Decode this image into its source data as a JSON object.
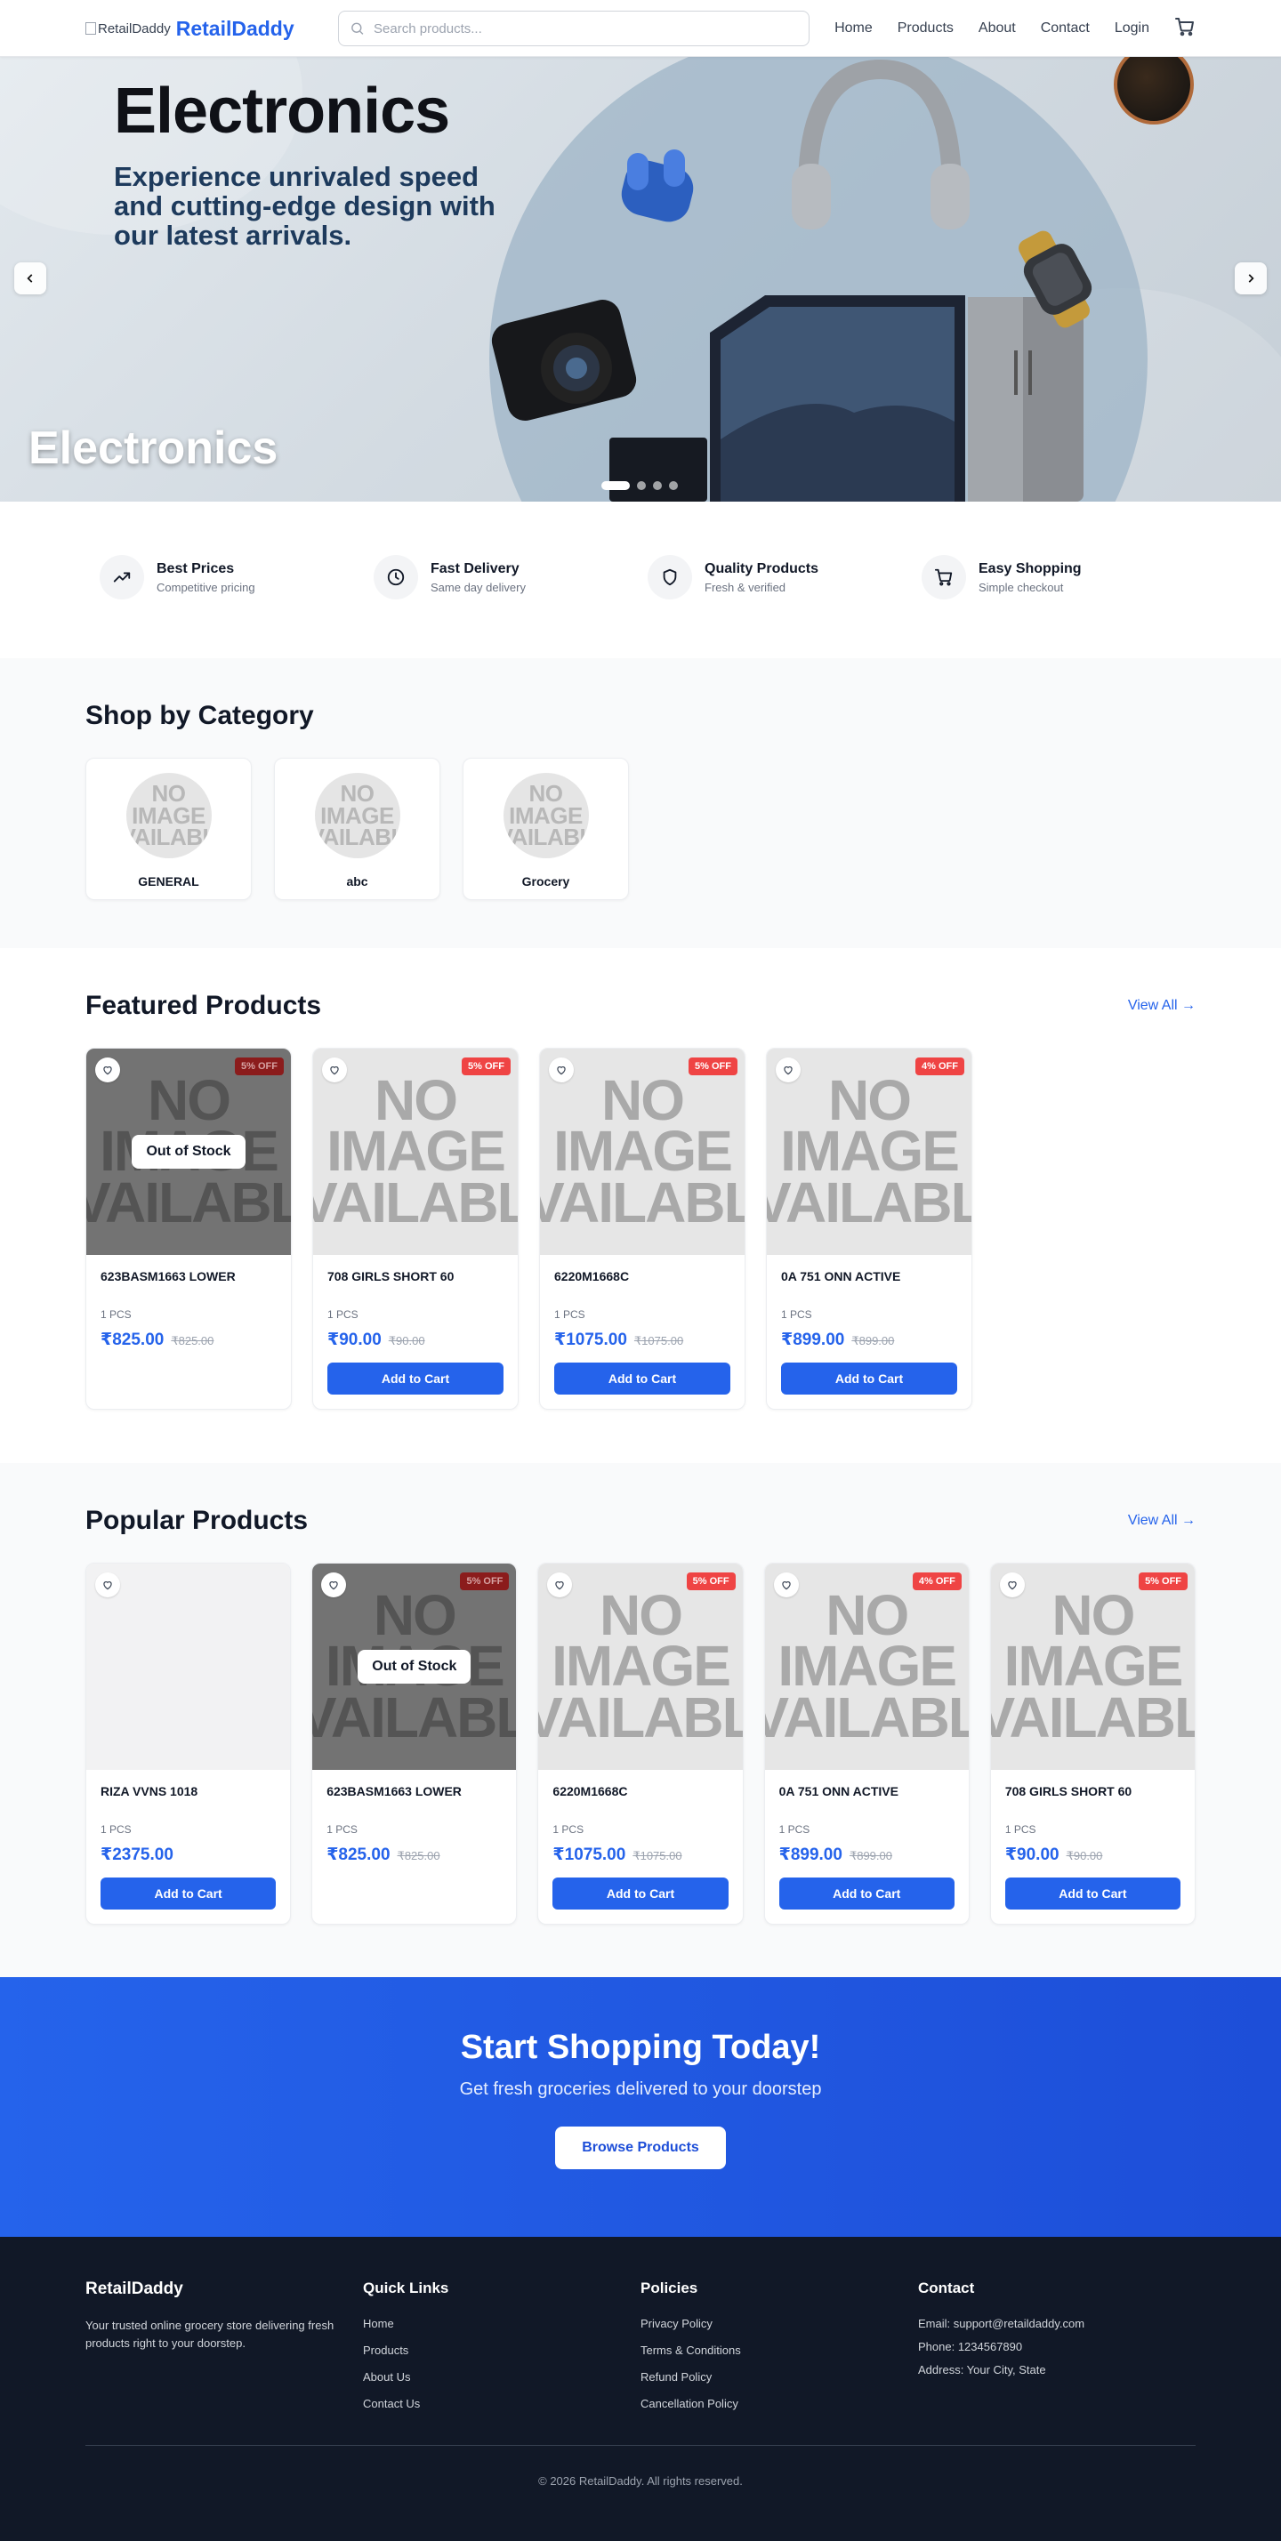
{
  "header": {
    "logo_alt": "RetailDaddy",
    "brand": "RetailDaddy",
    "search_placeholder": "Search products...",
    "nav": [
      "Home",
      "Products",
      "About",
      "Contact",
      "Login"
    ]
  },
  "hero": {
    "headline": "Electronics",
    "subtext": "Experience unrivaled speed and cutting-edge design with our latest arrivals.",
    "caption": "Electronics",
    "slide_count": 4,
    "active_slide": 0,
    "prev_icon": "chevron-left-icon",
    "next_icon": "chevron-right-icon"
  },
  "features": [
    {
      "title": "Best Prices",
      "subtitle": "Competitive pricing",
      "icon": "trending-up-icon"
    },
    {
      "title": "Fast Delivery",
      "subtitle": "Same day delivery",
      "icon": "clock-icon"
    },
    {
      "title": "Quality Products",
      "subtitle": "Fresh & verified",
      "icon": "shield-icon"
    },
    {
      "title": "Easy Shopping",
      "subtitle": "Simple checkout",
      "icon": "cart-icon"
    }
  ],
  "categories": {
    "title": "Shop by Category",
    "placeholder_text": [
      "NO",
      "IMAGE",
      "AVAILABLE"
    ],
    "items": [
      "GENERAL",
      "abc",
      "Grocery"
    ]
  },
  "featured": {
    "title": "Featured Products",
    "view_all": "View All →",
    "items": [
      {
        "name": "623BASM1663 LOWER",
        "unit": "1 PCS",
        "price": "₹825.00",
        "mrp": "₹825.00",
        "badge": "5% OFF",
        "out_of_stock": true,
        "image": "none"
      },
      {
        "name": "708 GIRLS SHORT 60",
        "unit": "1 PCS",
        "price": "₹90.00",
        "mrp": "₹90.00",
        "badge": "5% OFF",
        "out_of_stock": false,
        "image": "none"
      },
      {
        "name": "6220M1668C",
        "unit": "1 PCS",
        "price": "₹1075.00",
        "mrp": "₹1075.00",
        "badge": "5% OFF",
        "out_of_stock": false,
        "image": "none"
      },
      {
        "name": "0A 751 ONN ACTIVE",
        "unit": "1 PCS",
        "price": "₹899.00",
        "mrp": "₹899.00",
        "badge": "4% OFF",
        "out_of_stock": false,
        "image": "none"
      }
    ]
  },
  "popular": {
    "title": "Popular Products",
    "view_all": "View All →",
    "items": [
      {
        "name": "RIZA VVNS 1018",
        "unit": "1 PCS",
        "price": "₹2375.00",
        "mrp": "",
        "badge": "",
        "out_of_stock": false,
        "image": "blank"
      },
      {
        "name": "623BASM1663 LOWER",
        "unit": "1 PCS",
        "price": "₹825.00",
        "mrp": "₹825.00",
        "badge": "5% OFF",
        "out_of_stock": true,
        "image": "none"
      },
      {
        "name": "6220M1668C",
        "unit": "1 PCS",
        "price": "₹1075.00",
        "mrp": "₹1075.00",
        "badge": "5% OFF",
        "out_of_stock": false,
        "image": "none"
      },
      {
        "name": "0A 751 ONN ACTIVE",
        "unit": "1 PCS",
        "price": "₹899.00",
        "mrp": "₹899.00",
        "badge": "4% OFF",
        "out_of_stock": false,
        "image": "none"
      },
      {
        "name": "708 GIRLS SHORT 60",
        "unit": "1 PCS",
        "price": "₹90.00",
        "mrp": "₹90.00",
        "badge": "5% OFF",
        "out_of_stock": false,
        "image": "none"
      }
    ]
  },
  "labels": {
    "out_of_stock": "Out of Stock",
    "add_to_cart": "Add to Cart"
  },
  "cta": {
    "title": "Start Shopping Today!",
    "subtitle": "Get fresh groceries delivered to your doorstep",
    "button": "Browse Products"
  },
  "footer": {
    "brand": "RetailDaddy",
    "description": "Your trusted online grocery store delivering fresh products right to your doorstep.",
    "quick_links_title": "Quick Links",
    "quick_links": [
      "Home",
      "Products",
      "About Us",
      "Contact Us"
    ],
    "policies_title": "Policies",
    "policies": [
      "Privacy Policy",
      "Terms & Conditions",
      "Refund Policy",
      "Cancellation Policy"
    ],
    "contact_title": "Contact",
    "contact": [
      "Email: support@retaildaddy.com",
      "Phone: 1234567890",
      "Address: Your City, State"
    ],
    "copyright": "© 2026 RetailDaddy. All rights reserved."
  },
  "colors": {
    "brand": "#2563eb",
    "badge": "#ef4444",
    "footer_bg": "#111827"
  }
}
